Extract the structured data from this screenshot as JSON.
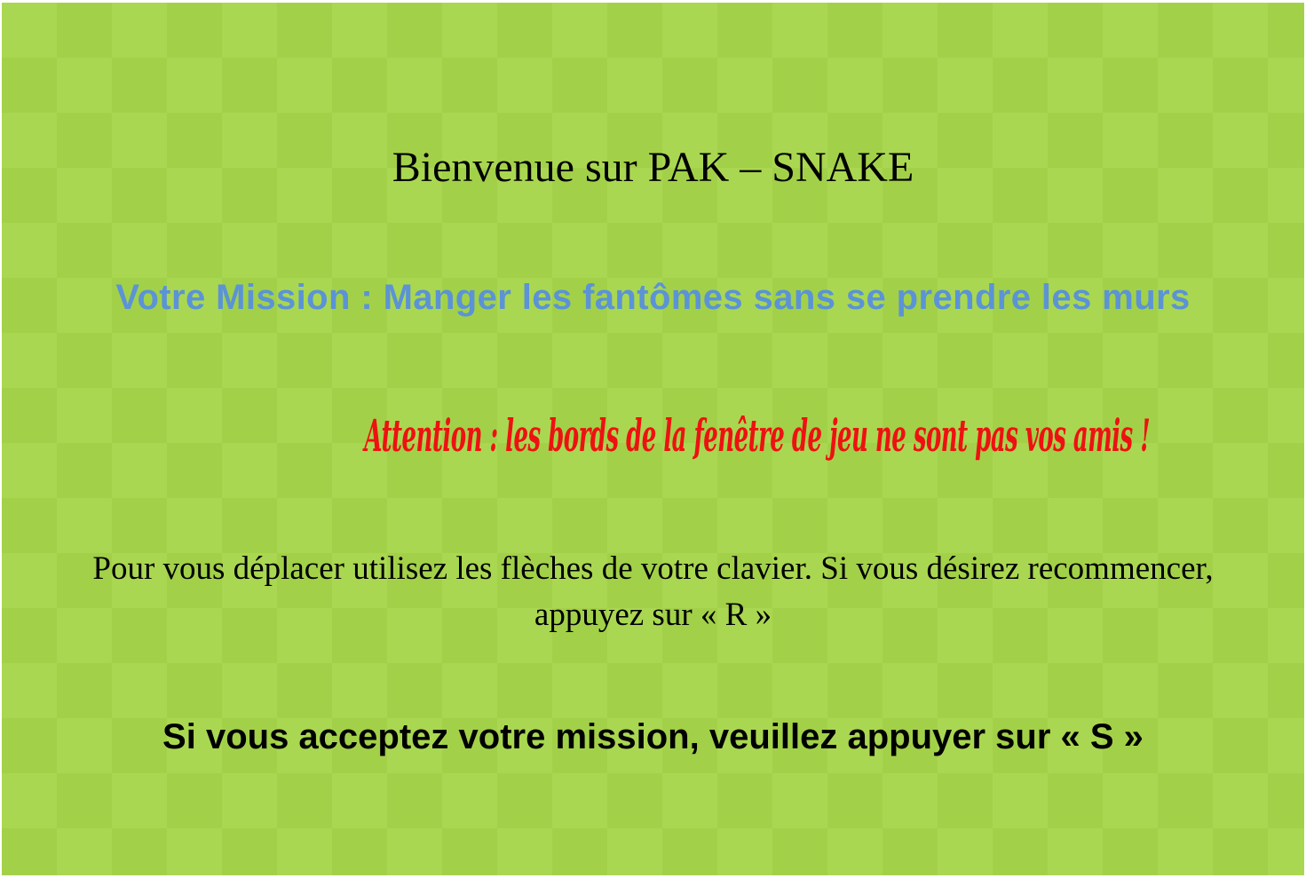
{
  "game": {
    "title": "Bienvenue sur PAK – SNAKE",
    "mission": "Votre Mission : Manger les fantômes sans se prendre les murs",
    "warning": "Attention : les bords de la fenêtre de jeu ne sont pas vos amis !",
    "instructions_line1": "Pour vous déplacer utilisez les flèches de votre clavier. Si vous désirez recommencer,",
    "instructions_line2": "appuyez sur « R »",
    "accept_prompt": "Si vous acceptez votre mission, veuillez appuyer sur « S »"
  },
  "colors": {
    "board_light": "#aad751",
    "board_dark": "#a2d149",
    "mission_text": "#5b93d6",
    "warning_text": "#ee1111",
    "body_text": "#000000"
  }
}
